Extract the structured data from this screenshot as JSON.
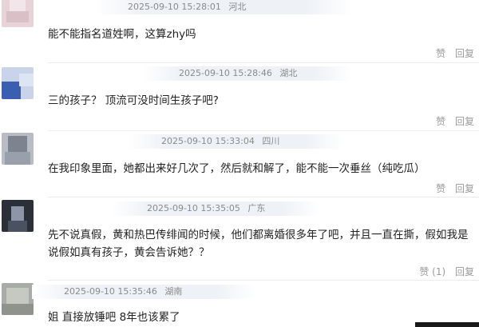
{
  "comments": [
    {
      "timestamp": "2025-09-10 15:28:01",
      "location": "河北",
      "text": "能不能指名道姓啊，这算zhy吗",
      "like_label": "赞",
      "reply_label": "回复"
    },
    {
      "timestamp": "2025-09-10 15:28:46",
      "location": "湖北",
      "text": "三的孩子？ 顶流可没时间生孩子吧?",
      "like_label": "赞",
      "reply_label": "回复"
    },
    {
      "timestamp": "2025-09-10 15:33:04",
      "location": "四川",
      "text": "在我印象里面，她都出来好几次了，然后就和解了，能不能一次垂丝（纯吃瓜）",
      "like_label": "赞",
      "reply_label": "回复"
    },
    {
      "timestamp": "2025-09-10 15:35:05",
      "location": "广东",
      "text": "先不说真假，黄和热巴传绯闻的时候，他们都离婚很多年了吧，并且一直在撕，假如我是说假如真有孩子，黄会告诉她？？",
      "like_label": "赞 (1)",
      "reply_label": "回复"
    },
    {
      "timestamp": "2025-09-10 15:35:46",
      "location": "湖南",
      "text": "姐 直接放锤吧 8年也该累了",
      "like_label": "",
      "reply_label": ""
    }
  ]
}
